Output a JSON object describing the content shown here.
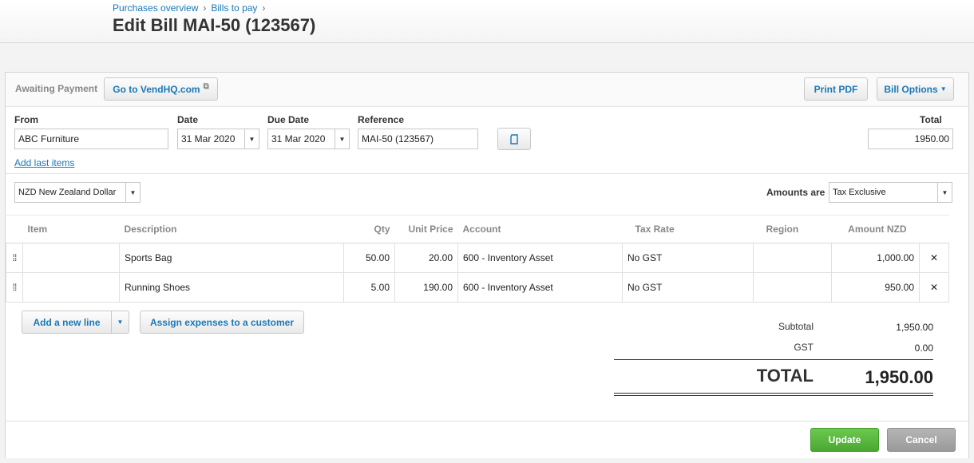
{
  "breadcrumb": [
    "Purchases overview",
    "Bills to pay"
  ],
  "page_title": "Edit Bill MAI-50 (123567)",
  "header": {
    "status": "Awaiting Payment",
    "goto_label": "Go to VendHQ.com",
    "print_label": "Print PDF",
    "options_label": "Bill Options"
  },
  "form": {
    "from_label": "From",
    "from_value": "ABC Furniture",
    "date_label": "Date",
    "date_value": "31 Mar 2020",
    "due_label": "Due Date",
    "due_value": "31 Mar 2020",
    "ref_label": "Reference",
    "ref_value": "MAI-50 (123567)",
    "total_label": "Total",
    "total_value": "1950.00",
    "add_last_items": "Add last items",
    "currency_value": "NZD New Zealand Dollar",
    "amounts_are_label": "Amounts are",
    "amounts_are_value": "Tax Exclusive"
  },
  "table": {
    "headers": [
      "Item",
      "Description",
      "Qty",
      "Unit Price",
      "Account",
      "Tax Rate",
      "Region",
      "Amount NZD"
    ],
    "rows": [
      {
        "item": "",
        "description": "Sports Bag",
        "qty": "50.00",
        "unit_price": "20.00",
        "account": "600 - Inventory Asset",
        "tax_rate": "No GST",
        "region": "",
        "amount": "1,000.00"
      },
      {
        "item": "",
        "description": "Running Shoes",
        "qty": "5.00",
        "unit_price": "190.00",
        "account": "600 - Inventory Asset",
        "tax_rate": "No GST",
        "region": "",
        "amount": "950.00"
      }
    ]
  },
  "actions": {
    "add_line": "Add a new line",
    "assign": "Assign expenses to a customer"
  },
  "summary": {
    "subtotal_label": "Subtotal",
    "subtotal_value": "1,950.00",
    "gst_label": "GST",
    "gst_value": "0.00",
    "total_label": "TOTAL",
    "total_value": "1,950.00"
  },
  "footer": {
    "update": "Update",
    "cancel": "Cancel"
  },
  "colors": {
    "link": "#1a79b7",
    "update_green": "#5bb93f",
    "cancel_grey": "#a8a8a8"
  }
}
